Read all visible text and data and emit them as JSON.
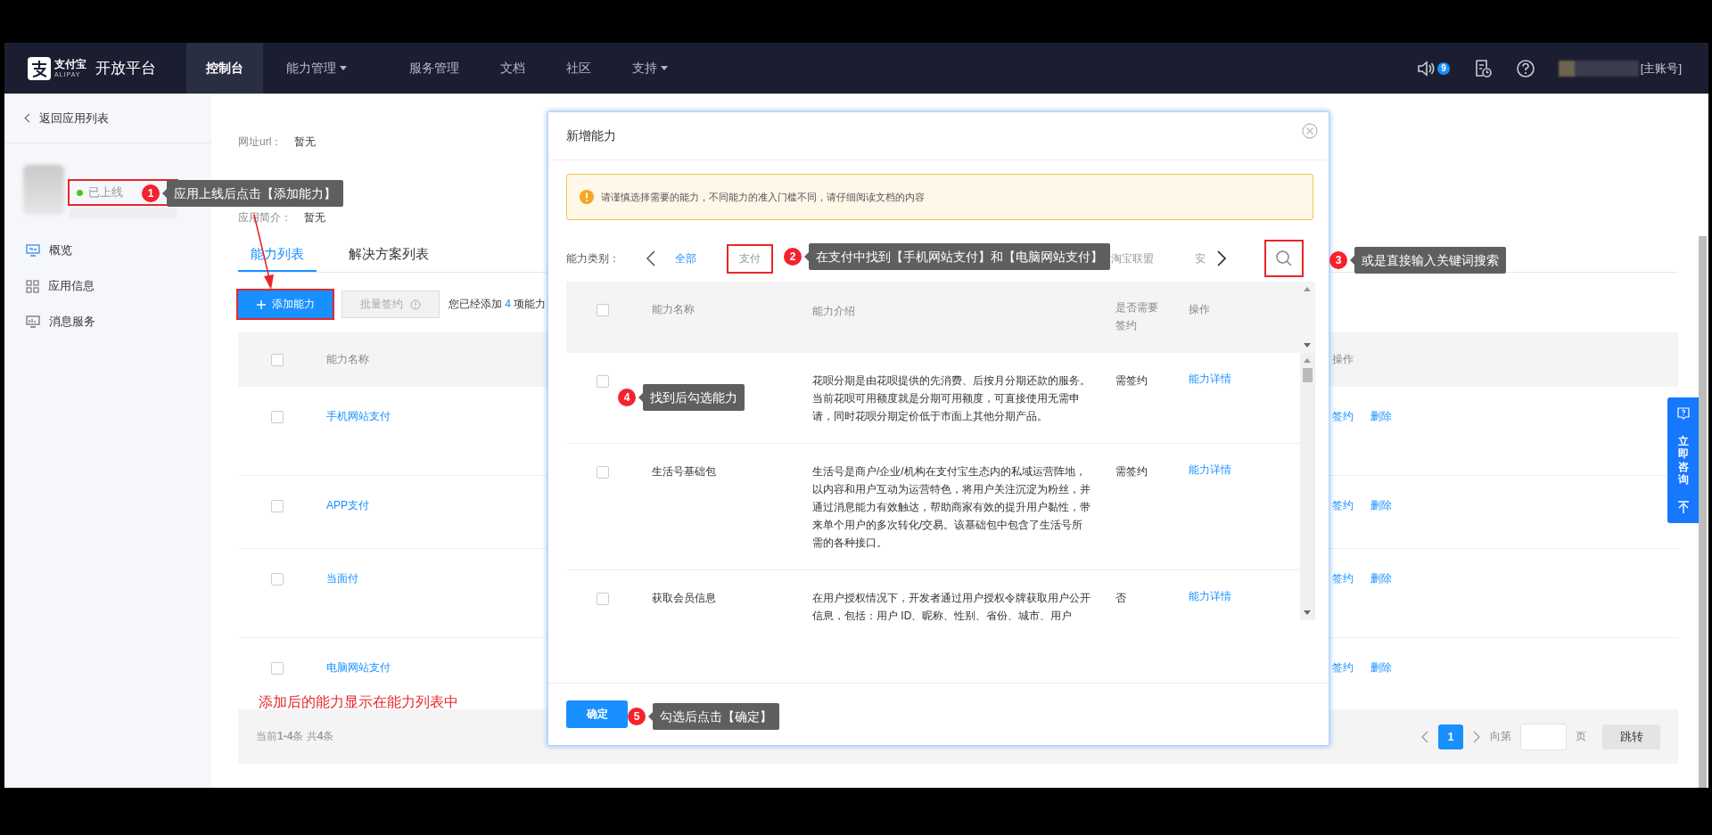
{
  "header": {
    "logo_cn": "支付宝",
    "logo_en": "ALIPAY",
    "brand": "开放平台",
    "nav": [
      {
        "label": "控制台",
        "selected": true,
        "dropdown": false
      },
      {
        "label": "能力管理",
        "selected": false,
        "dropdown": true
      },
      {
        "label": "服务管理",
        "selected": false,
        "dropdown": false
      },
      {
        "label": "文档",
        "selected": false,
        "dropdown": false
      },
      {
        "label": "社区",
        "selected": false,
        "dropdown": false
      },
      {
        "label": "支持",
        "selected": false,
        "dropdown": true
      }
    ],
    "notice_count": "9",
    "account": "[主账号]"
  },
  "sidebar": {
    "back": "返回应用列表",
    "status": {
      "label": "已上线",
      "highlighted": true
    },
    "items": [
      {
        "label": "概览",
        "kind": "monitor"
      },
      {
        "label": "应用信息",
        "kind": "grid"
      },
      {
        "label": "消息服务",
        "kind": "message"
      }
    ]
  },
  "info": [
    {
      "label": "网址url：",
      "value": "暂无"
    },
    {
      "label": "应用简介：",
      "value": "暂无"
    }
  ],
  "tabs": [
    {
      "label": "能力列表",
      "selected": true
    },
    {
      "label": "解决方案列表",
      "selected": false
    }
  ],
  "add_button": {
    "label": "添加能力",
    "highlighted": true
  },
  "batch_button": {
    "label": "批量签约",
    "disabled": true
  },
  "added_note": {
    "prefix": "您已经添加",
    "count": "4",
    "suffix": "项能力"
  },
  "table": {
    "columns": [
      "能力名称",
      "操作"
    ],
    "all_checked": false,
    "rows": [
      {
        "name": "手机网站支付",
        "checked": false,
        "actions": [
          "签约",
          "删除"
        ]
      },
      {
        "name": "APP支付",
        "checked": false,
        "actions": [
          "签约",
          "删除"
        ]
      },
      {
        "name": "当面付",
        "checked": false,
        "actions": [
          "签约",
          "删除"
        ]
      },
      {
        "name": "电脑网站支付",
        "checked": false,
        "actions": [
          "签约",
          "删除"
        ]
      }
    ],
    "footer": "当前**1-4**条 共**4**条"
  },
  "pagination": {
    "pages": [
      {
        "label": "1",
        "selected": true
      }
    ],
    "goto_label": "向第",
    "page_suffix": "页",
    "jump": "跳转"
  },
  "consult": {
    "label": "立即咨询"
  },
  "modal": {
    "title": "新增能力",
    "notice": "请谨慎选择需要的能力，不同能力的准入门槛不同，请仔细阅读文档的内容",
    "category_label": "能力类别：",
    "categories": [
      {
        "label": "全部",
        "selected": true,
        "highlighted": false
      },
      {
        "label": "支付",
        "selected": false,
        "highlighted": true
      },
      {
        "label": "淘宝联盟",
        "selected": false,
        "highlighted": false
      },
      {
        "label": "安",
        "selected": false,
        "highlighted": false
      }
    ],
    "search": {
      "highlighted": true
    },
    "columns": [
      "能力名称",
      "能力介绍",
      "是否需要签约",
      "操作"
    ],
    "all_checked": false,
    "rows": [
      {
        "checked": false,
        "intro": "花呗分期是由花呗提供的先消费、后按月分期还款的服务。当前花呗可用额度就是分期可用额度，可直接使用无需申请，同时花呗分期定价低于市面上其他分期产品。",
        "sign": "需签约",
        "action": "能力详情"
      },
      {
        "checked": false,
        "name": "生活号基础包",
        "intro": "生活号是商户/企业/机构在支付宝生态内的私域运营阵地，以内容和用户互动为运营特色，将用户关注沉淀为粉丝，并通过消息能力有效触达，帮助商家有效的提升用户黏性，带来单个用户的多次转化/交易。该基础包中包含了生活号所需的各种接口。",
        "sign": "需签约",
        "action": "能力详情"
      },
      {
        "checked": false,
        "name": "获取会员信息",
        "intro": "在用户授权情况下，开发者通过用户授权令牌获取用户公开信息，包括：用户 ID、昵称、性别、省份、城市、用户",
        "sign": "否",
        "action": "能力详情"
      }
    ],
    "confirm": "确定"
  },
  "callouts": [
    {
      "number": "1",
      "text": "应用上线后点击【添加能力】"
    },
    {
      "number": "2",
      "text": "在支付中找到【手机网站支付】和【电脑网站支付】"
    },
    {
      "number": "3",
      "text": "或是直接输入关键词搜索"
    },
    {
      "number": "4",
      "text": "找到后勾选能力"
    },
    {
      "number": "5",
      "text": "勾选后点击【确定】"
    }
  ],
  "note": "添加后的能力显示在能力列表中"
}
